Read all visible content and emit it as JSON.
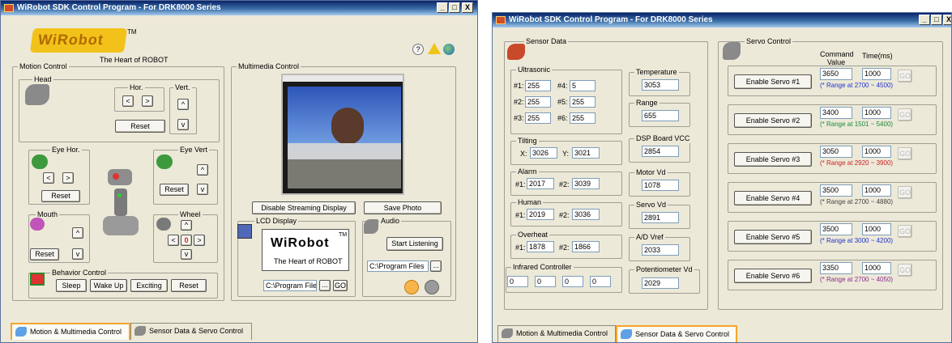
{
  "left_window": {
    "title": "WiRobot SDK Control Program - For DRK8000 Series",
    "controls": [
      "_",
      "□",
      "X"
    ],
    "logo_text": "WiRobot",
    "logo_tm": "TM",
    "tagline": "The Heart of ROBOT",
    "motion_control": {
      "label": "Motion Control",
      "head": {
        "label": "Head",
        "hor_label": "Hor.",
        "vert_label": "Vert.",
        "left": "<",
        "right": ">",
        "up": "^",
        "down": "v",
        "reset": "Reset"
      },
      "eye_hor": {
        "label": "Eye Hor.",
        "left": "<",
        "right": ">",
        "reset": "Reset"
      },
      "eye_vert": {
        "label": "Eye Vert",
        "up": "^",
        "down": "v",
        "reset": "Reset"
      },
      "mouth": {
        "label": "Mouth",
        "up": "^",
        "down": "v",
        "reset": "Reset"
      },
      "wheel": {
        "label": "Wheel",
        "up": "^",
        "left": "<",
        "center": "0",
        "right": ">",
        "down": "v"
      }
    },
    "behavior_control": {
      "label": "Behavior Control",
      "buttons": [
        "Sleep",
        "Wake Up",
        "Exciting",
        "Reset"
      ]
    },
    "multimedia": {
      "label": "Multimedia Control",
      "disable_streaming": "Disable Streaming Display",
      "save_photo": "Save Photo"
    },
    "lcd": {
      "label": "LCD Display",
      "logo": "WiRobot",
      "tm": "TM",
      "tagline": "The Heart of ROBOT",
      "path": "C:\\Program File",
      "browse": "...",
      "go": "GO"
    },
    "audio": {
      "label": "Audio",
      "start": "Start Listening",
      "path": "C:\\Program Files",
      "browse": "..."
    },
    "tabs": [
      "Motion & Multimedia Control",
      "Sensor Data & Servo Control"
    ]
  },
  "right_window": {
    "title": "WiRobot SDK Control Program - For DRK8000 Series",
    "controls": [
      "_",
      "□",
      "X"
    ],
    "sensor": {
      "label": "Sensor Data",
      "ultrasonic": {
        "label": "Ultrasonic",
        "items": [
          {
            "k": "#1:",
            "v": "255"
          },
          {
            "k": "#4:",
            "v": "5"
          },
          {
            "k": "#2:",
            "v": "255"
          },
          {
            "k": "#5:",
            "v": "255"
          },
          {
            "k": "#3:",
            "v": "255"
          },
          {
            "k": "#6:",
            "v": "255"
          }
        ]
      },
      "tilting": {
        "label": "Tilting",
        "x_label": "X:",
        "x": "3026",
        "y_label": "Y:",
        "y": "3021"
      },
      "alarm": {
        "label": "Alarm",
        "a1": "#1:",
        "v1": "2017",
        "a2": "#2:",
        "v2": "3039"
      },
      "human": {
        "label": "Human",
        "a1": "#1:",
        "v1": "2019",
        "a2": "#2:",
        "v2": "3036"
      },
      "overheat": {
        "label": "Overheat",
        "a1": "#1:",
        "v1": "1878",
        "a2": "#2:",
        "v2": "1866"
      },
      "infrared": {
        "label": "Infrared Controller",
        "values": [
          "0",
          "0",
          "0",
          "0"
        ]
      },
      "temperature": {
        "label": "Temperature",
        "value": "3053"
      },
      "range": {
        "label": "Range",
        "value": "655"
      },
      "dsp": {
        "label": "DSP Board VCC",
        "value": "2854"
      },
      "motor": {
        "label": "Motor Vd",
        "value": "1078"
      },
      "servo_vd": {
        "label": "Servo Vd",
        "value": "2891"
      },
      "ad_vref": {
        "label": "A/D Vref",
        "value": "2033"
      },
      "pot": {
        "label": "Potentiometer Vd",
        "value": "2029"
      }
    },
    "servo": {
      "label": "Servo Control",
      "col_cmd": "Command Value",
      "col_time": "Time(ms)",
      "go": "GO",
      "rows": [
        {
          "btn": "Enable Servo #1",
          "cmd": "3650",
          "time": "1000",
          "range": "(* Range at 2700 ~ 4500)",
          "color": "#2233cc"
        },
        {
          "btn": "Enable Servo #2",
          "cmd": "3400",
          "time": "1000",
          "range": "(* Range at 1501 ~ 5400)",
          "color": "#1a8a3a"
        },
        {
          "btn": "Enable Servo #3",
          "cmd": "3050",
          "time": "1000",
          "range": "(* Range at 2920 ~ 3900)",
          "color": "#cc2222"
        },
        {
          "btn": "Enable Servo #4",
          "cmd": "3500",
          "time": "1000",
          "range": "(* Range at 2700 ~ 4880)",
          "color": "#444444"
        },
        {
          "btn": "Enable Servo #5",
          "cmd": "3500",
          "time": "1000",
          "range": "(* Range at 3000 ~ 4200)",
          "color": "#2233cc"
        },
        {
          "btn": "Enable Servo #6",
          "cmd": "3350",
          "time": "1000",
          "range": "(* Range at 2700 ~ 4050)",
          "color": "#8a2a8a"
        }
      ]
    },
    "tabs": [
      "Motion & Multimedia Control",
      "Sensor Data & Servo Control"
    ]
  }
}
